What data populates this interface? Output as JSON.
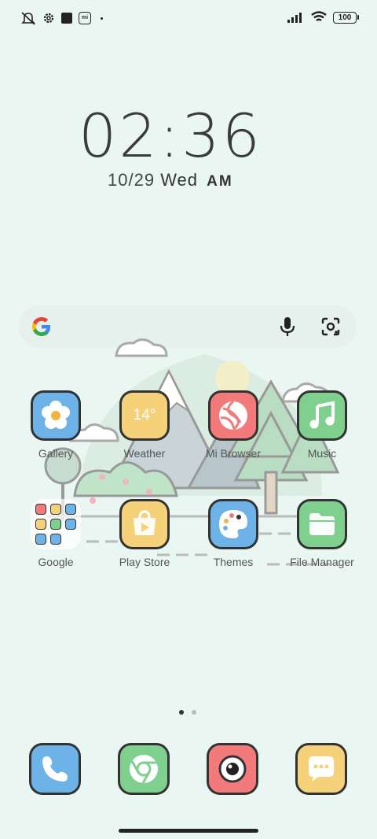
{
  "status": {
    "battery": "100"
  },
  "clock": {
    "time_h": "02",
    "time_m": "36",
    "date": "10/29",
    "weekday": "Wed",
    "ampm": "AM"
  },
  "apps": [
    {
      "name": "Gallery",
      "color": "#6eb3e8"
    },
    {
      "name": "Weather",
      "color": "#f5d17a",
      "temp": "14°"
    },
    {
      "name": "Mi Browser",
      "color": "#f27a7a"
    },
    {
      "name": "Music",
      "color": "#7fd08e"
    },
    {
      "name": "Google"
    },
    {
      "name": "Play Store",
      "color": "#f5d17a"
    },
    {
      "name": "Themes",
      "color": "#6eb3e8"
    },
    {
      "name": "File Manager",
      "color": "#7fd08e"
    }
  ],
  "dock": [
    {
      "icon": "phone-icon",
      "color": "#6eb3e8"
    },
    {
      "icon": "chrome-icon",
      "color": "#7fd08e"
    },
    {
      "icon": "camera-icon",
      "color": "#f27a7a"
    },
    {
      "icon": "messages-icon",
      "color": "#f5d17a"
    }
  ]
}
